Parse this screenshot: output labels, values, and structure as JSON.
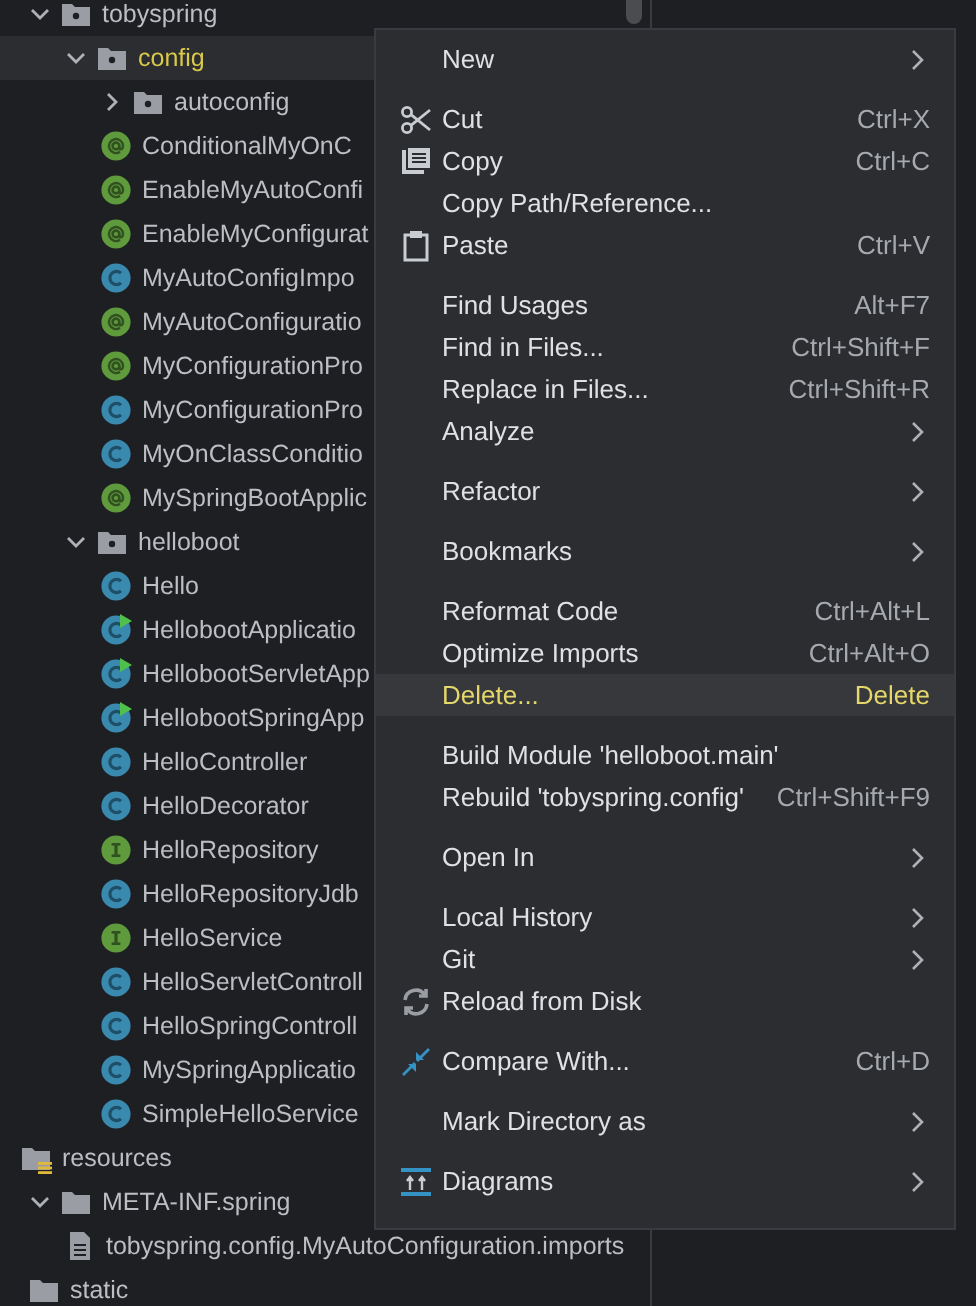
{
  "tree": [
    {
      "name": "tobyspring",
      "kind": "package",
      "expanded": true,
      "selected": false,
      "children": [
        {
          "name": "config",
          "kind": "package",
          "expanded": true,
          "selected": true,
          "children": [
            {
              "name": "autoconfig",
              "kind": "package",
              "expanded": false,
              "selected": false
            },
            {
              "name": "ConditionalMyOnC",
              "kind": "annotation",
              "selected": false
            },
            {
              "name": "EnableMyAutoConfi",
              "kind": "annotation",
              "selected": false
            },
            {
              "name": "EnableMyConfigurat",
              "kind": "annotation",
              "selected": false
            },
            {
              "name": "MyAutoConfigImpo",
              "kind": "class",
              "selected": false
            },
            {
              "name": "MyAutoConfiguratio",
              "kind": "annotation",
              "selected": false
            },
            {
              "name": "MyConfigurationPro",
              "kind": "annotation",
              "selected": false
            },
            {
              "name": "MyConfigurationPro",
              "kind": "class",
              "selected": false
            },
            {
              "name": "MyOnClassConditio",
              "kind": "class",
              "selected": false
            },
            {
              "name": "MySpringBootApplic",
              "kind": "annotation",
              "selected": false
            }
          ]
        },
        {
          "name": "helloboot",
          "kind": "package",
          "expanded": true,
          "selected": false,
          "children": [
            {
              "name": "Hello",
              "kind": "class",
              "selected": false
            },
            {
              "name": "HellobootApplicatio",
              "kind": "main_class",
              "selected": false
            },
            {
              "name": "HellobootServletApp",
              "kind": "main_class",
              "selected": false
            },
            {
              "name": "HellobootSpringApp",
              "kind": "main_class",
              "selected": false
            },
            {
              "name": "HelloController",
              "kind": "class",
              "selected": false
            },
            {
              "name": "HelloDecorator",
              "kind": "class",
              "selected": false
            },
            {
              "name": "HelloRepository",
              "kind": "interface",
              "selected": false
            },
            {
              "name": "HelloRepositoryJdb",
              "kind": "class",
              "selected": false
            },
            {
              "name": "HelloService",
              "kind": "interface",
              "selected": false
            },
            {
              "name": "HelloServletControll",
              "kind": "class",
              "selected": false
            },
            {
              "name": "HelloSpringControll",
              "kind": "class",
              "selected": false
            },
            {
              "name": "MySpringApplicatio",
              "kind": "class",
              "selected": false
            },
            {
              "name": "SimpleHelloService",
              "kind": "class",
              "selected": false
            }
          ]
        }
      ]
    },
    {
      "name": "resources",
      "kind": "resources",
      "selected": false,
      "children": [
        {
          "name": "META-INF.spring",
          "kind": "folder",
          "expanded": true,
          "selected": false,
          "children": [
            {
              "name": "tobyspring.config.MyAutoConfiguration.imports",
              "kind": "file",
              "selected": false
            }
          ]
        },
        {
          "name": "static",
          "kind": "folder",
          "selected": false
        }
      ]
    }
  ],
  "context_menu": {
    "groups": [
      [
        {
          "label": "New",
          "submenu": true,
          "selected": false
        }
      ],
      [
        {
          "label": "Cut",
          "shortcut": "Ctrl+X",
          "selected": false
        },
        {
          "label": "Copy",
          "shortcut": "Ctrl+C",
          "selected": false
        },
        {
          "label": "Copy Path/Reference...",
          "selected": false
        },
        {
          "label": "Paste",
          "shortcut": "Ctrl+V",
          "selected": false
        }
      ],
      [
        {
          "label": "Find Usages",
          "shortcut": "Alt+F7",
          "selected": false
        },
        {
          "label": "Find in Files...",
          "shortcut": "Ctrl+Shift+F",
          "selected": false
        },
        {
          "label": "Replace in Files...",
          "shortcut": "Ctrl+Shift+R",
          "selected": false
        },
        {
          "label": "Analyze",
          "submenu": true,
          "selected": false
        }
      ],
      [
        {
          "label": "Refactor",
          "submenu": true,
          "selected": false
        }
      ],
      [
        {
          "label": "Bookmarks",
          "submenu": true,
          "selected": false
        }
      ],
      [
        {
          "label": "Reformat Code",
          "shortcut": "Ctrl+Alt+L",
          "selected": false
        },
        {
          "label": "Optimize Imports",
          "shortcut": "Ctrl+Alt+O",
          "selected": false
        },
        {
          "label": "Delete...",
          "shortcut": "Delete",
          "selected": true
        }
      ],
      [
        {
          "label": "Build Module 'helloboot.main'",
          "selected": false
        },
        {
          "label": "Rebuild 'tobyspring.config'",
          "shortcut": "Ctrl+Shift+F9",
          "selected": false
        }
      ],
      [
        {
          "label": "Open In",
          "submenu": true,
          "selected": false
        }
      ],
      [
        {
          "label": "Local History",
          "submenu": true,
          "selected": false
        },
        {
          "label": "Git",
          "submenu": true,
          "selected": false
        },
        {
          "label": "Reload from Disk",
          "selected": false
        }
      ],
      [
        {
          "label": "Compare With...",
          "shortcut": "Ctrl+D",
          "selected": false
        }
      ],
      [
        {
          "label": "Mark Directory as",
          "submenu": true,
          "selected": false
        }
      ],
      [
        {
          "label": "Diagrams",
          "submenu": true,
          "selected": false
        }
      ]
    ]
  }
}
